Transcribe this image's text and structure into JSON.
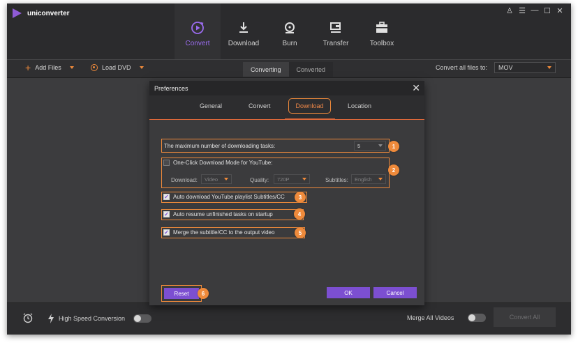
{
  "app": {
    "name": "uniconverter"
  },
  "window_controls": {
    "user": "♙",
    "menu": "☰",
    "minimize": "—",
    "maximize": "☐",
    "close": "✕"
  },
  "nav": [
    {
      "label": "Convert",
      "icon": "convert-icon",
      "active": true
    },
    {
      "label": "Download",
      "icon": "download-icon",
      "active": false
    },
    {
      "label": "Burn",
      "icon": "burn-icon",
      "active": false
    },
    {
      "label": "Transfer",
      "icon": "transfer-icon",
      "active": false
    },
    {
      "label": "Toolbox",
      "icon": "toolbox-icon",
      "active": false
    }
  ],
  "toolbar": {
    "add_files": "Add Files",
    "load_dvd": "Load DVD",
    "tabs": [
      "Converting",
      "Converted"
    ],
    "convert_all_label": "Convert all files to:",
    "format": "MOV"
  },
  "bottombar": {
    "high_speed": "High Speed Conversion",
    "merge_all": "Merge All Videos",
    "convert_all": "Convert All"
  },
  "dialog": {
    "title": "Preferences",
    "tabs": [
      "General",
      "Convert",
      "Download",
      "Location"
    ],
    "active_tab": "Download",
    "max_tasks_label": "The maximum number of downloading tasks:",
    "max_tasks_value": "5",
    "one_click_label": "One-Click Download Mode for YouTube:",
    "download_label": "Download:",
    "download_value": "Video",
    "quality_label": "Quality:",
    "quality_value": "720P",
    "subtitles_label": "Subtitles:",
    "subtitles_value": "English",
    "auto_download_label": "Auto download YouTube playlist Subtitles/CC",
    "auto_resume_label": "Auto resume unfinished tasks on startup",
    "merge_subtitle_label": "Merge the subtitle/CC to the output video",
    "reset": "Reset",
    "ok": "OK",
    "cancel": "Cancel",
    "badges": [
      "1",
      "2",
      "3",
      "4",
      "5",
      "6"
    ]
  },
  "colors": {
    "accent_purple": "#7c4fd1",
    "highlight_orange": "#ef8a3b",
    "background": "#3a3a3c"
  }
}
